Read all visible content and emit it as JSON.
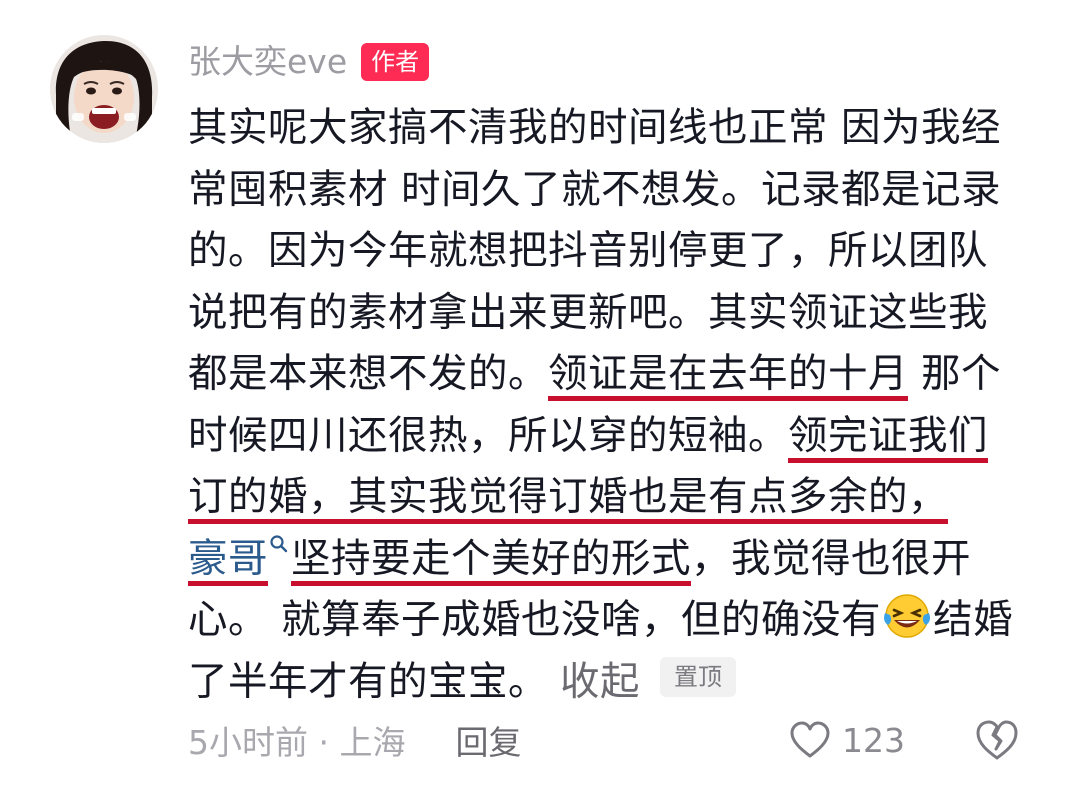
{
  "author": {
    "name": "张大奕eve",
    "badge": "作者"
  },
  "comment": {
    "line1": "其实呢大家搞不清我的时间线也正常 因为我经",
    "line2": "常囤积素材 时间久了就不想发。记录都是记录",
    "line3": "的。因为今年就想把抖音别停更了，所以团队",
    "line4": "说把有的素材拿出来更新吧。其实领证这些我",
    "line5_a": "都是本来想不发的。",
    "line5_hl": "领证是在去年的十月",
    "line5_b": " 那个",
    "line6_a": "时候四川还很热，所以穿的短袖。",
    "line6_hl": "领完证我们",
    "line7_hl": "订的婚，其实我觉得订婚也是有点多余的，",
    "line8_mention": "豪哥",
    "line8_hl": "坚持要走个美好的形式",
    "line8_b": "，我觉得也很开",
    "line9_a": "心。 就算奉子成婚也没啥，但的确没有",
    "line9_b": "结婚",
    "line10": "了半年才有的宝宝。",
    "emoji": "laughing-tears-emoji",
    "underline_color": "#c8102e"
  },
  "actions": {
    "collapse_label": "收起",
    "pinned_label": "置顶",
    "time_location": "5小时前 · 上海",
    "reply_label": "回复",
    "like_count": "123"
  },
  "colors": {
    "badge": "#fe2c55",
    "mention": "#2b5a8c",
    "text": "#161823",
    "meta": "#a8a8ae"
  }
}
